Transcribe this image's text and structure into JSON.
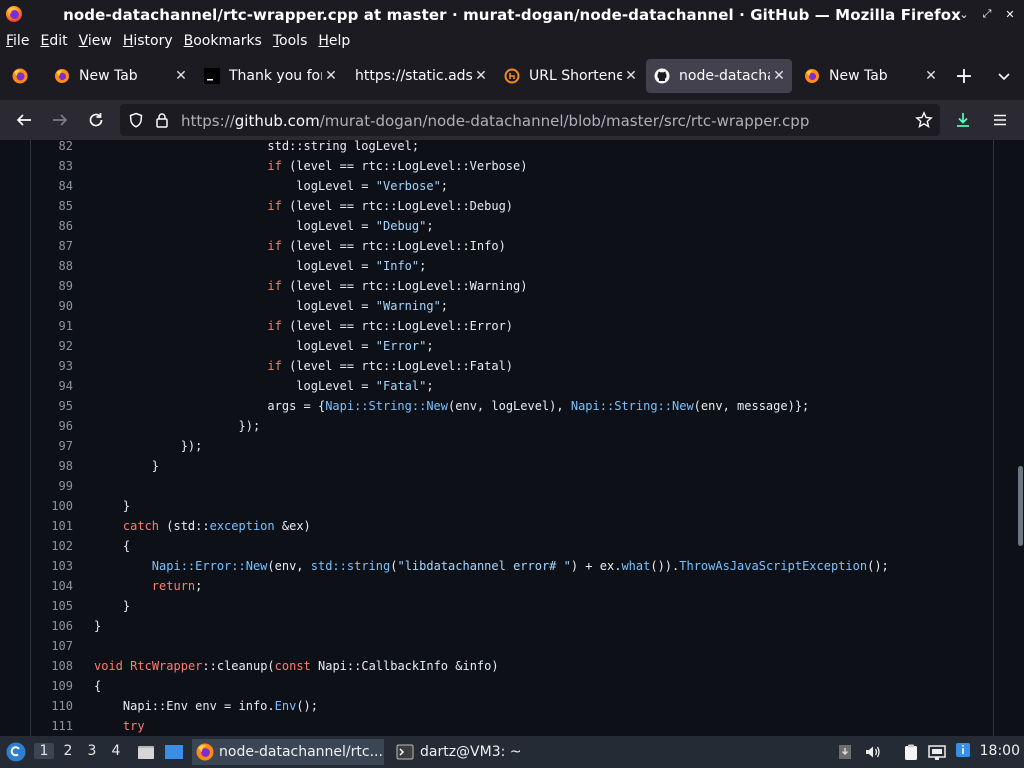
{
  "window": {
    "title": "node-datachannel/rtc-wrapper.cpp at master · murat-dogan/node-datachannel · GitHub — Mozilla Firefox",
    "controls": {
      "minimize": "⌄",
      "maximize": "⤢",
      "close": "✕"
    }
  },
  "menu": [
    {
      "label": "File",
      "access_key": "F",
      "rest": "ile"
    },
    {
      "label": "Edit",
      "access_key": "E",
      "rest": "dit"
    },
    {
      "label": "View",
      "access_key": "V",
      "rest": "iew"
    },
    {
      "label": "History",
      "access_key": "H",
      "rest": "istory"
    },
    {
      "label": "Bookmarks",
      "access_key": "B",
      "rest": "ookmarks"
    },
    {
      "label": "Tools",
      "access_key": "T",
      "rest": "ools"
    },
    {
      "label": "Help",
      "access_key": "H",
      "rest": "elp"
    }
  ],
  "tabs": [
    {
      "title": "New Tab",
      "icon": "firefox-icon",
      "active": false
    },
    {
      "title": "Thank you for",
      "icon": "terminal-icon",
      "active": false
    },
    {
      "title": "https://static.ads",
      "icon": "none",
      "active": false
    },
    {
      "title": "URL Shortene",
      "icon": "urlshortener-icon",
      "active": false
    },
    {
      "title": "node-datacha",
      "icon": "github-icon",
      "active": true
    },
    {
      "title": "New Tab",
      "icon": "firefox-icon",
      "active": false
    }
  ],
  "tab_controls": {
    "new_tab": "+",
    "list_all": "⌄"
  },
  "navbar": {
    "url_prefix": "https://",
    "url_domain": "github.com",
    "url_path": "/murat-dogan/node-datachannel/blob/master/src/rtc-wrapper.cpp"
  },
  "code": {
    "lines": [
      {
        "n": "82",
        "t": "                        std::string logLevel;"
      },
      {
        "n": "83",
        "t": "                        if (level == rtc::LogLevel::Verbose)"
      },
      {
        "n": "84",
        "t": "                            logLevel = \"Verbose\";"
      },
      {
        "n": "85",
        "t": "                        if (level == rtc::LogLevel::Debug)"
      },
      {
        "n": "86",
        "t": "                            logLevel = \"Debug\";"
      },
      {
        "n": "87",
        "t": "                        if (level == rtc::LogLevel::Info)"
      },
      {
        "n": "88",
        "t": "                            logLevel = \"Info\";"
      },
      {
        "n": "89",
        "t": "                        if (level == rtc::LogLevel::Warning)"
      },
      {
        "n": "90",
        "t": "                            logLevel = \"Warning\";"
      },
      {
        "n": "91",
        "t": "                        if (level == rtc::LogLevel::Error)"
      },
      {
        "n": "92",
        "t": "                            logLevel = \"Error\";"
      },
      {
        "n": "93",
        "t": "                        if (level == rtc::LogLevel::Fatal)"
      },
      {
        "n": "94",
        "t": "                            logLevel = \"Fatal\";"
      },
      {
        "n": "95",
        "t": "                        args = {Napi::String::New(env, logLevel), Napi::String::New(env, message)};"
      },
      {
        "n": "96",
        "t": "                    });"
      },
      {
        "n": "97",
        "t": "            });"
      },
      {
        "n": "98",
        "t": "        }"
      },
      {
        "n": "99",
        "t": ""
      },
      {
        "n": "100",
        "t": "    }"
      },
      {
        "n": "101",
        "t": "    catch (std::exception &ex)"
      },
      {
        "n": "102",
        "t": "    {"
      },
      {
        "n": "103",
        "t": "        Napi::Error::New(env, std::string(\"libdatachannel error# \") + ex.what()).ThrowAsJavaScriptException();"
      },
      {
        "n": "104",
        "t": "        return;"
      },
      {
        "n": "105",
        "t": "    }"
      },
      {
        "n": "106",
        "t": "}"
      },
      {
        "n": "107",
        "t": ""
      },
      {
        "n": "108",
        "t": "void RtcWrapper::cleanup(const Napi::CallbackInfo &info)"
      },
      {
        "n": "109",
        "t": "{"
      },
      {
        "n": "110",
        "t": "    Napi::Env env = info.Env();"
      },
      {
        "n": "111",
        "t": "    try"
      }
    ]
  },
  "taskbar": {
    "workspaces": [
      "1",
      "2",
      "3",
      "4"
    ],
    "active_workspace": "1",
    "tasks": [
      {
        "label": "node-datachannel/rtc...",
        "icon": "firefox-icon",
        "active": true
      },
      {
        "label": "dartz@VM3: ~",
        "icon": "terminal-icon",
        "active": false
      }
    ],
    "clock": "18:00"
  },
  "colors": {
    "keyword": "#ff7b72",
    "string": "#a5d6ff",
    "function": "#79c0ff",
    "text": "#e6edf3",
    "line_number": "#8b949e",
    "code_bg": "#0d1117",
    "chrome_bg": "#1c1b22",
    "active_tab": "#42414d",
    "download_accent": "#54ffbd"
  }
}
